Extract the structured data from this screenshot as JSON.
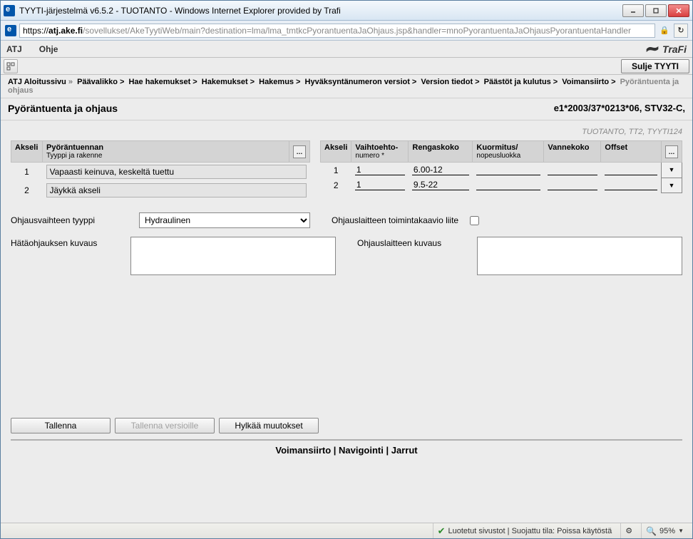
{
  "window": {
    "title": "TYYTI-järjestelmä v6.5.2 - TUOTANTO - Windows Internet Explorer provided by Trafi",
    "url_https": "https://",
    "url_host": "atj.ake.fi",
    "url_path": "/sovellukset/AkeTyytiWeb/main?destination=lma/lma_tmtkcPyorantuentaJaOhjaus.jsp&handler=mnoPyorantuentaJaOhjausPyorantuentaHandler"
  },
  "menu": {
    "atj": "ATJ",
    "ohje": "Ohje",
    "brand": "TraFi",
    "close": "Sulje TYYTI"
  },
  "breadcrumb": {
    "items": [
      "ATJ Aloitussivu",
      "Päävalikko",
      "Hae hakemukset",
      "Hakemukset",
      "Hakemus",
      "Hyväksyntänumeron versiot",
      "Version tiedot",
      "Päästöt ja kulutus",
      "Voimansiirto"
    ],
    "current": "Pyöräntuenta ja ohjaus"
  },
  "page": {
    "title": "Pyöräntuenta ja ohjaus",
    "ref": "e1*2003/37*0213*06, STV32-C,",
    "env": "TUOTANTO, TT2, TYYTI124"
  },
  "left_headers": {
    "akseli": "Akseli",
    "pyorantuennan": "Pyöräntuennan",
    "tyyppi": "Tyyppi ja rakenne"
  },
  "left_rows": [
    {
      "no": "1",
      "val": "Vapaasti keinuva, keskeltä tuettu"
    },
    {
      "no": "2",
      "val": "Jäykkä akseli"
    }
  ],
  "right_headers": {
    "akseli": "Akseli",
    "vaihtoehto": "Vaihtoehto-",
    "numero": "numero *",
    "rengaskoko": "Rengaskoko",
    "kuormitus": "Kuormitus/",
    "nopeus": "nopeusluokka",
    "vannekoko": "Vannekoko",
    "offset": "Offset"
  },
  "right_rows": [
    {
      "no": "1",
      "vaihto": "1",
      "rengas": "6.00-12",
      "kuorm": "",
      "vanne": "",
      "off": ""
    },
    {
      "no": "2",
      "vaihto": "1",
      "rengas": "9.5-22",
      "kuorm": "",
      "vanne": "",
      "off": ""
    }
  ],
  "form": {
    "ohjausvaihteen_tyyppi_label": "Ohjausvaihteen tyyppi",
    "ohjausvaihteen_tyyppi_value": "Hydraulinen",
    "ohjauslaitteen_liite_label": "Ohjauslaitteen toimintakaavio liite",
    "hataohjaus_label": "Hätäohjauksen kuvaus",
    "hataohjaus_value": "",
    "ohjauslaite_label": "Ohjauslaitteen kuvaus",
    "ohjauslaite_value": ""
  },
  "buttons": {
    "tallenna": "Tallenna",
    "tallenna_versioille": "Tallenna versioille",
    "hylkaa": "Hylkää muutokset"
  },
  "footer_nav": {
    "a": "Voimansiirto",
    "b": "Navigointi",
    "c": "Jarrut"
  },
  "status": {
    "trusted": "Luotetut sivustot | Suojattu tila: Poissa käytöstä",
    "zoom": "95%"
  }
}
